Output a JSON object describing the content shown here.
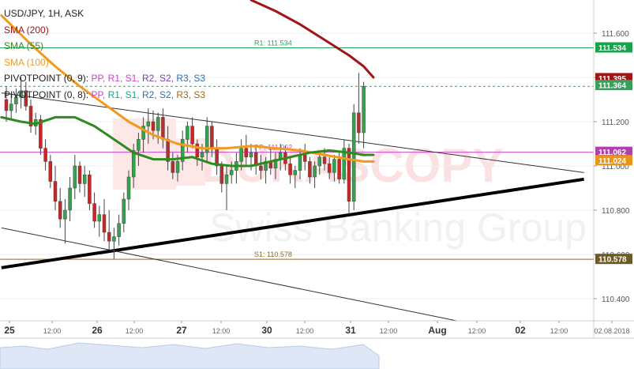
{
  "chart_data": {
    "type": "candlestick",
    "title": "USD/JPY, 1H, ASK",
    "instrument": "USD/JPY",
    "timeframe": "1H",
    "price_side": "ASK",
    "watermark": "DUKASCOPY Swiss Banking Group",
    "ylim": [
      110.3,
      111.75
    ],
    "y_ticks": [
      "111.600",
      "111.400",
      "111.200",
      "111.000",
      "110.800",
      "110.600",
      "110.400"
    ],
    "x_ticks": [
      "25",
      "12:00",
      "26",
      "12:00",
      "27",
      "12:00",
      "30",
      "12:00",
      "31",
      "12:00",
      "Aug",
      "12:00",
      "02",
      "12:00",
      "02.08.2018"
    ],
    "indicators": [
      {
        "label": "SMA (200)",
        "color": "#a31515"
      },
      {
        "label": "SMA (55)",
        "color": "#2e8b1f"
      },
      {
        "label": "SMA (100)",
        "color": "#f39a1e"
      }
    ],
    "pivot_legends": [
      {
        "prefix": "PIVOTPOINT (0, 9): ",
        "items": [
          {
            "text": "PP",
            "color": "#cc44cc"
          },
          {
            "text": "R1",
            "color": "#cc44cc"
          },
          {
            "text": "S1",
            "color": "#cc44cc"
          },
          {
            "text": "R2",
            "color": "#7a3fb5"
          },
          {
            "text": "S2",
            "color": "#7a3fb5"
          },
          {
            "text": "R3",
            "color": "#2f6fb3"
          },
          {
            "text": "S3",
            "color": "#2f6fb3"
          }
        ]
      },
      {
        "prefix": "PIVOTPOINT (0, 8): ",
        "items": [
          {
            "text": "PP",
            "color": "#cc44cc"
          },
          {
            "text": "R1",
            "color": "#17a589"
          },
          {
            "text": "S1",
            "color": "#17a589"
          },
          {
            "text": "R2",
            "color": "#2f6fb3"
          },
          {
            "text": "S2",
            "color": "#2f6fb3"
          },
          {
            "text": "R3",
            "color": "#9a6b1a"
          },
          {
            "text": "S3",
            "color": "#9a6b1a"
          }
        ]
      }
    ],
    "horizontal_lines": [
      {
        "name": "R1",
        "label": "R1: 111.534",
        "value": 111.534,
        "color": "#26a65b"
      },
      {
        "name": "PP",
        "label": "PP: 111.062",
        "value": 111.062,
        "color": "#cc44cc"
      },
      {
        "name": "S1",
        "label": "S1: 110.578",
        "value": 110.578,
        "color": "#8b6a2b"
      }
    ],
    "price_tags": [
      {
        "value": 111.534,
        "text": "111.534",
        "color": "#16a34a"
      },
      {
        "value": 111.395,
        "text": "111.395",
        "color": "#a31515"
      },
      {
        "value": 111.364,
        "text": "111.364",
        "color": "#3b9f5c"
      },
      {
        "value": 111.062,
        "text": "111.062",
        "color": "#b040b0"
      },
      {
        "value": 111.024,
        "text": "111.024",
        "color": "#e8951a"
      },
      {
        "value": 110.578,
        "text": "110.578",
        "color": "#6e5a24"
      }
    ],
    "trendlines": [
      {
        "name": "support",
        "color": "#000000",
        "width": "thick",
        "points": [
          [
            -1,
            110.54
          ],
          [
            118,
            110.94
          ]
        ]
      },
      {
        "name": "channel-upper",
        "color": "#333333",
        "width": "thin",
        "points": [
          [
            -1,
            111.33
          ],
          [
            118,
            110.97
          ]
        ]
      },
      {
        "name": "channel-lower",
        "color": "#333333",
        "width": "thin",
        "points": [
          [
            -1,
            110.72
          ],
          [
            92,
            110.3
          ]
        ]
      }
    ],
    "candles": [
      [
        111.3,
        111.36,
        111.2,
        111.25
      ],
      [
        111.25,
        111.33,
        111.21,
        111.28
      ],
      [
        111.28,
        111.35,
        111.24,
        111.31
      ],
      [
        111.31,
        111.4,
        111.26,
        111.34
      ],
      [
        111.34,
        111.38,
        111.25,
        111.27
      ],
      [
        111.27,
        111.3,
        111.15,
        111.18
      ],
      [
        111.18,
        111.24,
        111.14,
        111.21
      ],
      [
        111.21,
        111.23,
        111.05,
        111.08
      ],
      [
        111.08,
        111.12,
        110.98,
        111.02
      ],
      [
        111.02,
        111.05,
        110.9,
        110.93
      ],
      [
        110.93,
        111.0,
        110.8,
        110.84
      ],
      [
        110.84,
        110.9,
        110.72,
        110.76
      ],
      [
        110.76,
        110.85,
        110.65,
        110.8
      ],
      [
        110.8,
        110.95,
        110.75,
        110.9
      ],
      [
        110.9,
        111.05,
        110.85,
        111.0
      ],
      [
        111.0,
        111.02,
        110.88,
        110.92
      ],
      [
        110.92,
        111.0,
        110.86,
        110.96
      ],
      [
        110.96,
        110.98,
        110.8,
        110.83
      ],
      [
        110.83,
        110.88,
        110.72,
        110.75
      ],
      [
        110.75,
        110.82,
        110.68,
        110.78
      ],
      [
        110.78,
        110.85,
        110.66,
        110.7
      ],
      [
        110.7,
        110.8,
        110.62,
        110.66
      ],
      [
        110.66,
        110.72,
        110.58,
        110.68
      ],
      [
        110.68,
        110.78,
        110.64,
        110.74
      ],
      [
        110.74,
        110.88,
        110.7,
        110.85
      ],
      [
        110.85,
        110.98,
        110.8,
        110.95
      ],
      [
        110.95,
        111.1,
        110.9,
        111.07
      ],
      [
        111.07,
        111.15,
        111.0,
        111.12
      ],
      [
        111.12,
        111.22,
        111.06,
        111.18
      ],
      [
        111.18,
        111.26,
        111.1,
        111.2
      ],
      [
        111.2,
        111.25,
        111.12,
        111.16
      ],
      [
        111.16,
        111.24,
        111.1,
        111.22
      ],
      [
        111.22,
        111.26,
        111.08,
        111.12
      ],
      [
        111.12,
        111.18,
        110.98,
        111.02
      ],
      [
        111.02,
        111.06,
        110.94,
        110.97
      ],
      [
        110.97,
        111.05,
        110.93,
        111.02
      ],
      [
        111.02,
        111.16,
        110.98,
        111.12
      ],
      [
        111.12,
        111.2,
        111.06,
        111.18
      ],
      [
        111.18,
        111.22,
        111.08,
        111.1
      ],
      [
        111.1,
        111.12,
        111.0,
        111.04
      ],
      [
        111.04,
        111.1,
        110.98,
        111.06
      ],
      [
        111.06,
        111.22,
        111.02,
        111.18
      ],
      [
        111.18,
        111.2,
        111.04,
        111.08
      ],
      [
        111.08,
        111.12,
        110.96,
        111.0
      ],
      [
        111.0,
        111.02,
        110.88,
        110.92
      ],
      [
        110.92,
        111.0,
        110.8,
        110.96
      ],
      [
        110.96,
        111.02,
        110.92,
        110.98
      ],
      [
        110.98,
        111.06,
        110.92,
        111.02
      ],
      [
        111.02,
        111.12,
        110.98,
        111.08
      ],
      [
        111.08,
        111.14,
        111.0,
        111.04
      ],
      [
        111.04,
        111.1,
        110.98,
        111.06
      ],
      [
        111.06,
        111.08,
        110.96,
        111.0
      ],
      [
        111.0,
        111.05,
        110.94,
        110.98
      ],
      [
        110.98,
        111.04,
        110.92,
        111.02
      ],
      [
        111.02,
        111.08,
        110.96,
        110.99
      ],
      [
        110.99,
        111.06,
        110.94,
        111.03
      ],
      [
        111.03,
        111.1,
        110.98,
        111.06
      ],
      [
        111.06,
        111.09,
        110.98,
        111.01
      ],
      [
        111.01,
        111.04,
        110.92,
        110.96
      ],
      [
        110.96,
        111.0,
        110.9,
        110.98
      ],
      [
        110.98,
        111.08,
        110.94,
        111.05
      ],
      [
        111.05,
        111.1,
        110.98,
        111.02
      ],
      [
        111.02,
        111.04,
        110.92,
        110.95
      ],
      [
        110.95,
        111.02,
        110.9,
        111.0
      ],
      [
        111.0,
        111.06,
        110.96,
        111.04
      ],
      [
        111.04,
        111.08,
        110.98,
        111.01
      ],
      [
        111.01,
        111.04,
        110.94,
        110.97
      ],
      [
        110.97,
        111.05,
        110.93,
        111.03
      ],
      [
        111.03,
        111.06,
        110.92,
        110.94
      ],
      [
        110.94,
        111.12,
        110.92,
        111.08
      ],
      [
        111.08,
        111.1,
        110.78,
        110.84
      ],
      [
        110.84,
        111.28,
        110.8,
        111.24
      ],
      [
        111.24,
        111.42,
        111.1,
        111.15
      ],
      [
        111.15,
        111.38,
        111.08,
        111.36
      ]
    ],
    "series": [
      {
        "name": "SMA (200)",
        "color": "#a31515",
        "x": [
          50,
          55,
          60,
          65,
          70,
          73,
          75
        ],
        "values": [
          111.75,
          111.7,
          111.64,
          111.57,
          111.5,
          111.45,
          111.4
        ]
      },
      {
        "name": "SMA (100)",
        "color": "#f39a1e",
        "x": [
          -1,
          5,
          10,
          15,
          20,
          25,
          30,
          35,
          40,
          45,
          50,
          55,
          60,
          65,
          70,
          73,
          75
        ],
        "values": [
          111.68,
          111.55,
          111.45,
          111.36,
          111.28,
          111.2,
          111.14,
          111.1,
          111.08,
          111.08,
          111.09,
          111.08,
          111.07,
          111.05,
          111.03,
          111.02,
          111.02
        ]
      },
      {
        "name": "SMA (55)",
        "color": "#2e8b1f",
        "x": [
          -1,
          3,
          6,
          10,
          14,
          18,
          22,
          26,
          30,
          34,
          38,
          42,
          46,
          50,
          54,
          58,
          62,
          66,
          70,
          73,
          75
        ],
        "values": [
          111.22,
          111.2,
          111.19,
          111.22,
          111.22,
          111.18,
          111.12,
          111.06,
          111.03,
          111.03,
          111.04,
          111.01,
          111.0,
          111.0,
          111.02,
          111.04,
          111.06,
          111.07,
          111.06,
          111.05,
          111.05
        ]
      }
    ],
    "volume_panel": "area"
  }
}
